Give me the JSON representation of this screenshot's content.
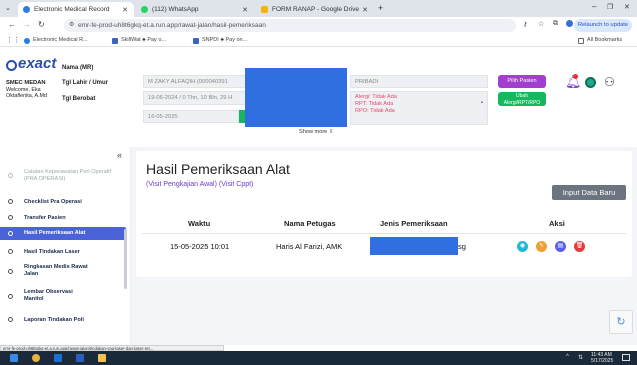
{
  "browser": {
    "tabs": [
      {
        "label": "Electronic Medical Record",
        "color": "#2a7be4",
        "active": true
      },
      {
        "label": "(112) WhatsApp",
        "color": "#25d366",
        "active": false
      },
      {
        "label": "FORM RANAP - Google Drive",
        "color": "#f4b400",
        "active": false
      }
    ],
    "new_tab": "+",
    "url": "emr-fe-prod-uh8t6gkq-et.a.run.app/rawat-jalan/hasil-pemeriksaan",
    "update_label": "Relaunch to update",
    "bookmarks": [
      "Electronic Medical R...",
      "SkillWat ♣ Pay o...",
      "SNPDI ♣ Pay on..."
    ],
    "all_bookmarks": "All Bookmarks"
  },
  "app": {
    "logo": "exact",
    "hospital": "SMEC MEDAN",
    "welcome_line1": "Welcome, Eka",
    "welcome_line2": "Oktaflenita, A.Md",
    "labels": {
      "name": "Nama (MR)",
      "dob": "Tgl Lahir / Umur",
      "visit_date": "Tgl Berobat"
    },
    "values": {
      "name": "M ZAKY ALFAQIH (000040391",
      "dob": "19-06-2024 / 0 Thn, 10 Bln, 29 H",
      "visit_date": "16-05-2025",
      "payer": "PRIBADI",
      "alergi": "Alergi: Tidak Ada",
      "rpt": "RPT: Tidak Ada",
      "rpo": "RPO: Tidak Ada",
      "show_more": "Show more ⇩"
    },
    "buttons": {
      "pilih_pasien": "Pilih Pasien",
      "ubah": "Ubah\nAlergi/RPT/RPO"
    }
  },
  "sidebar": {
    "collapse_icon": "«",
    "items": [
      {
        "label": "Catatan Keperawatan Peri Operatif (PRA OPERASI)",
        "active": false,
        "muted": true
      },
      {
        "label": "Checklist Pra Operasi",
        "active": false
      },
      {
        "label": "Transfer Pasien",
        "active": false
      },
      {
        "label": "Hasil Pemeriksaan Alat",
        "active": true
      },
      {
        "label": "Hasil Tindakan Laser",
        "active": false
      },
      {
        "label": "Ringkasan Medis Rawat Jalan",
        "active": false
      },
      {
        "label": "Lembar Observasi Manitol",
        "active": false
      },
      {
        "label": "Laporan Tindakan Poli",
        "active": false
      }
    ]
  },
  "main": {
    "title": "Hasil Pemeriksaan Alat",
    "links": "(Visit Pengkajian Awal)  (Visit Cppt)",
    "input_button": "Input Data Baru",
    "headers": [
      "Waktu",
      "Nama Petugas",
      "Jenis Pemeriksaan",
      "Aksi"
    ],
    "rows": [
      {
        "waktu": "15-05-2025 10:01",
        "petugas": "Haris Al Farizi, AMK",
        "jenis_suffix": "sg"
      }
    ]
  },
  "status_url": "emr-fe-prod-uh8t6gkq-et.a.run.app/rawat-jalan/tindakan-yag-laser-dan-laser-ret...",
  "taskbar": {
    "time": "11:43 AM",
    "date": "5/17/2025"
  },
  "colors": {
    "accent": "#4b63d9",
    "purple": "#a23fd0",
    "green": "#16b85f",
    "redact": "#2f6fe0"
  }
}
